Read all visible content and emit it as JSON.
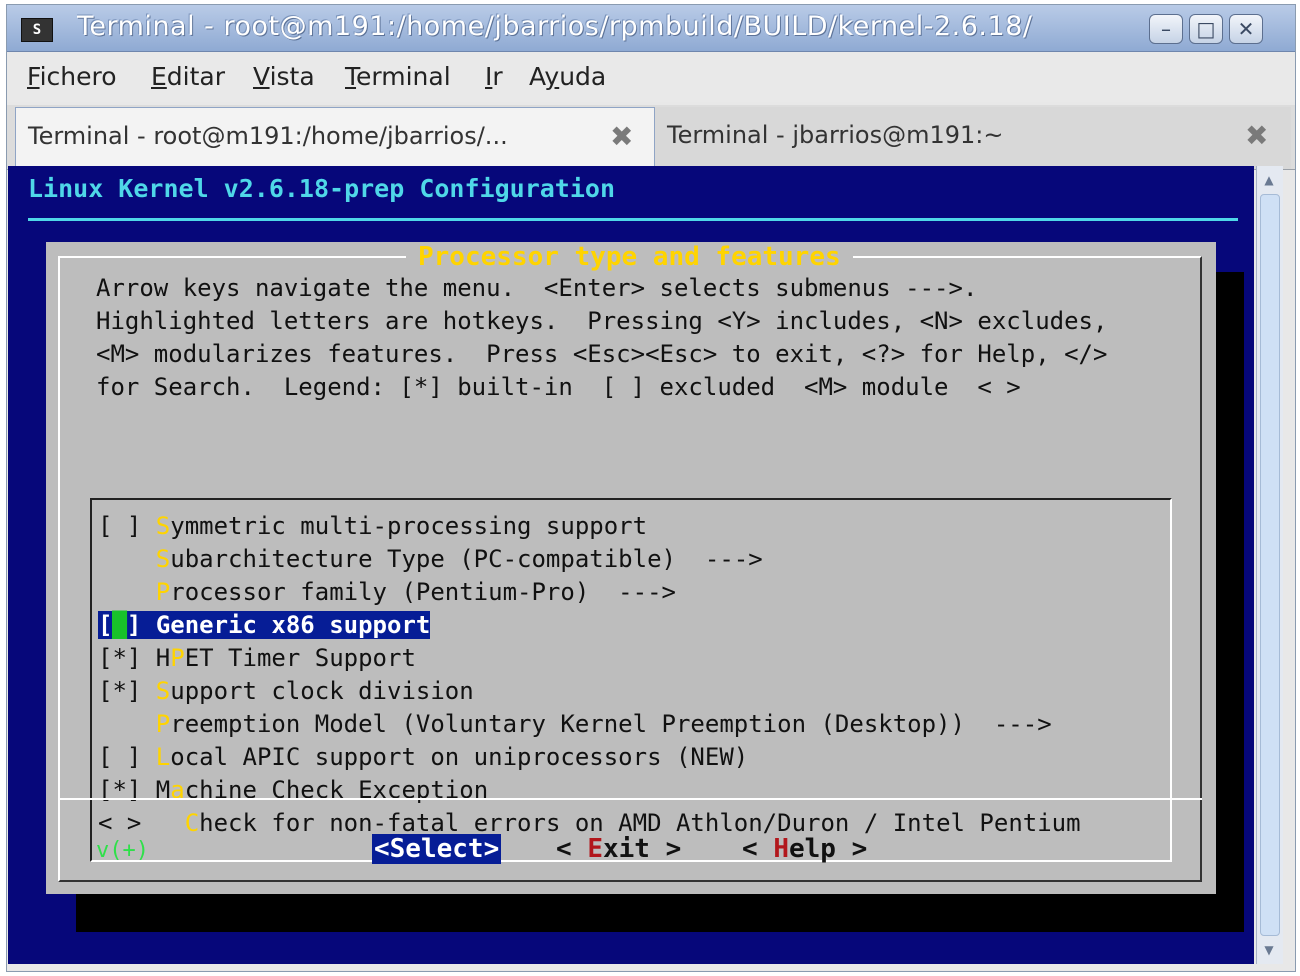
{
  "window": {
    "title": "Terminal - root@m191:/home/jbarrios/rpmbuild/BUILD/kernel-2.6.18/",
    "icon_label": "S",
    "controls": [
      "minimize-icon",
      "maximize-icon",
      "close-icon"
    ]
  },
  "menubar": {
    "items": [
      {
        "hotkey": "F",
        "rest": "ichero"
      },
      {
        "hotkey": "E",
        "rest": "ditar"
      },
      {
        "hotkey": "V",
        "rest": "ista"
      },
      {
        "hotkey": "T",
        "rest": "erminal"
      },
      {
        "hotkey": "I",
        "rest": "r"
      },
      {
        "pre": "A",
        "hotkey": "y",
        "rest": "uda"
      }
    ]
  },
  "tabs": [
    {
      "label": "Terminal - root@m191:/home/jbarrios/...",
      "active": true
    },
    {
      "label": "Terminal - jbarrios@m191:~",
      "active": false
    }
  ],
  "terminal": {
    "header": "Linux Kernel v2.6.18-prep Configuration",
    "dialog": {
      "title": "Processor type and features",
      "help_lines": [
        "Arrow keys navigate the menu.  <Enter> selects submenus --->.",
        "Highlighted letters are hotkeys.  Pressing <Y> includes, <N> excludes,",
        "<M> modularizes features.  Press <Esc><Esc> to exit, <?> for Help, </>",
        "for Search.  Legend: [*] built-in  [ ] excluded  <M> module  < >"
      ],
      "options": [
        {
          "prefix": "[ ] ",
          "pre": "",
          "hotkey": "S",
          "rest": "ymmetric multi-processing support"
        },
        {
          "prefix": "    ",
          "pre": "",
          "hotkey": "S",
          "rest": "ubarchitecture Type (PC-compatible)  --->"
        },
        {
          "prefix": "    ",
          "pre": "",
          "hotkey": "P",
          "rest": "rocessor family (Pentium-Pro)  --->"
        },
        {
          "prefix": "[ ] ",
          "pre": "",
          "hotkey": "G",
          "rest": "eneric x86 support",
          "selected": true
        },
        {
          "prefix": "[*] ",
          "pre": "H",
          "hotkey": "P",
          "rest": "ET Timer Support"
        },
        {
          "prefix": "[*] ",
          "pre": "",
          "hotkey": "S",
          "rest": "upport clock division"
        },
        {
          "prefix": "    ",
          "pre": "",
          "hotkey": "P",
          "rest": "reemption Model (Voluntary Kernel Preemption (Desktop))  --->"
        },
        {
          "prefix": "[ ] ",
          "pre": "",
          "hotkey": "L",
          "rest": "ocal APIC support on uniprocessors (NEW)"
        },
        {
          "prefix": "[*] ",
          "pre": "M",
          "hotkey": "a",
          "rest": "chine Check Exception"
        },
        {
          "prefix": "< > ",
          "pre": "  ",
          "hotkey": "C",
          "rest": "heck for non-fatal errors on AMD Athlon/Duron / Intel Pentium"
        }
      ],
      "more_indicator": "v(+)",
      "buttons": {
        "select": "<Select>",
        "exit_pre": "< ",
        "exit_hk": "E",
        "exit_rest": "xit",
        "exit_post": " >",
        "help_pre": "< ",
        "help_hk": "H",
        "help_rest": "elp",
        "help_post": " >"
      }
    }
  },
  "colors": {
    "terminal_bg": "#06077a",
    "header_text": "#4fd7e8",
    "dialog_bg": "#bdbdbd",
    "dialog_title": "#ffd400",
    "hotkey": "#ffd400",
    "selection_bg": "#061d96",
    "cursor": "#18c22a",
    "button_hotkey": "#b2171c"
  }
}
